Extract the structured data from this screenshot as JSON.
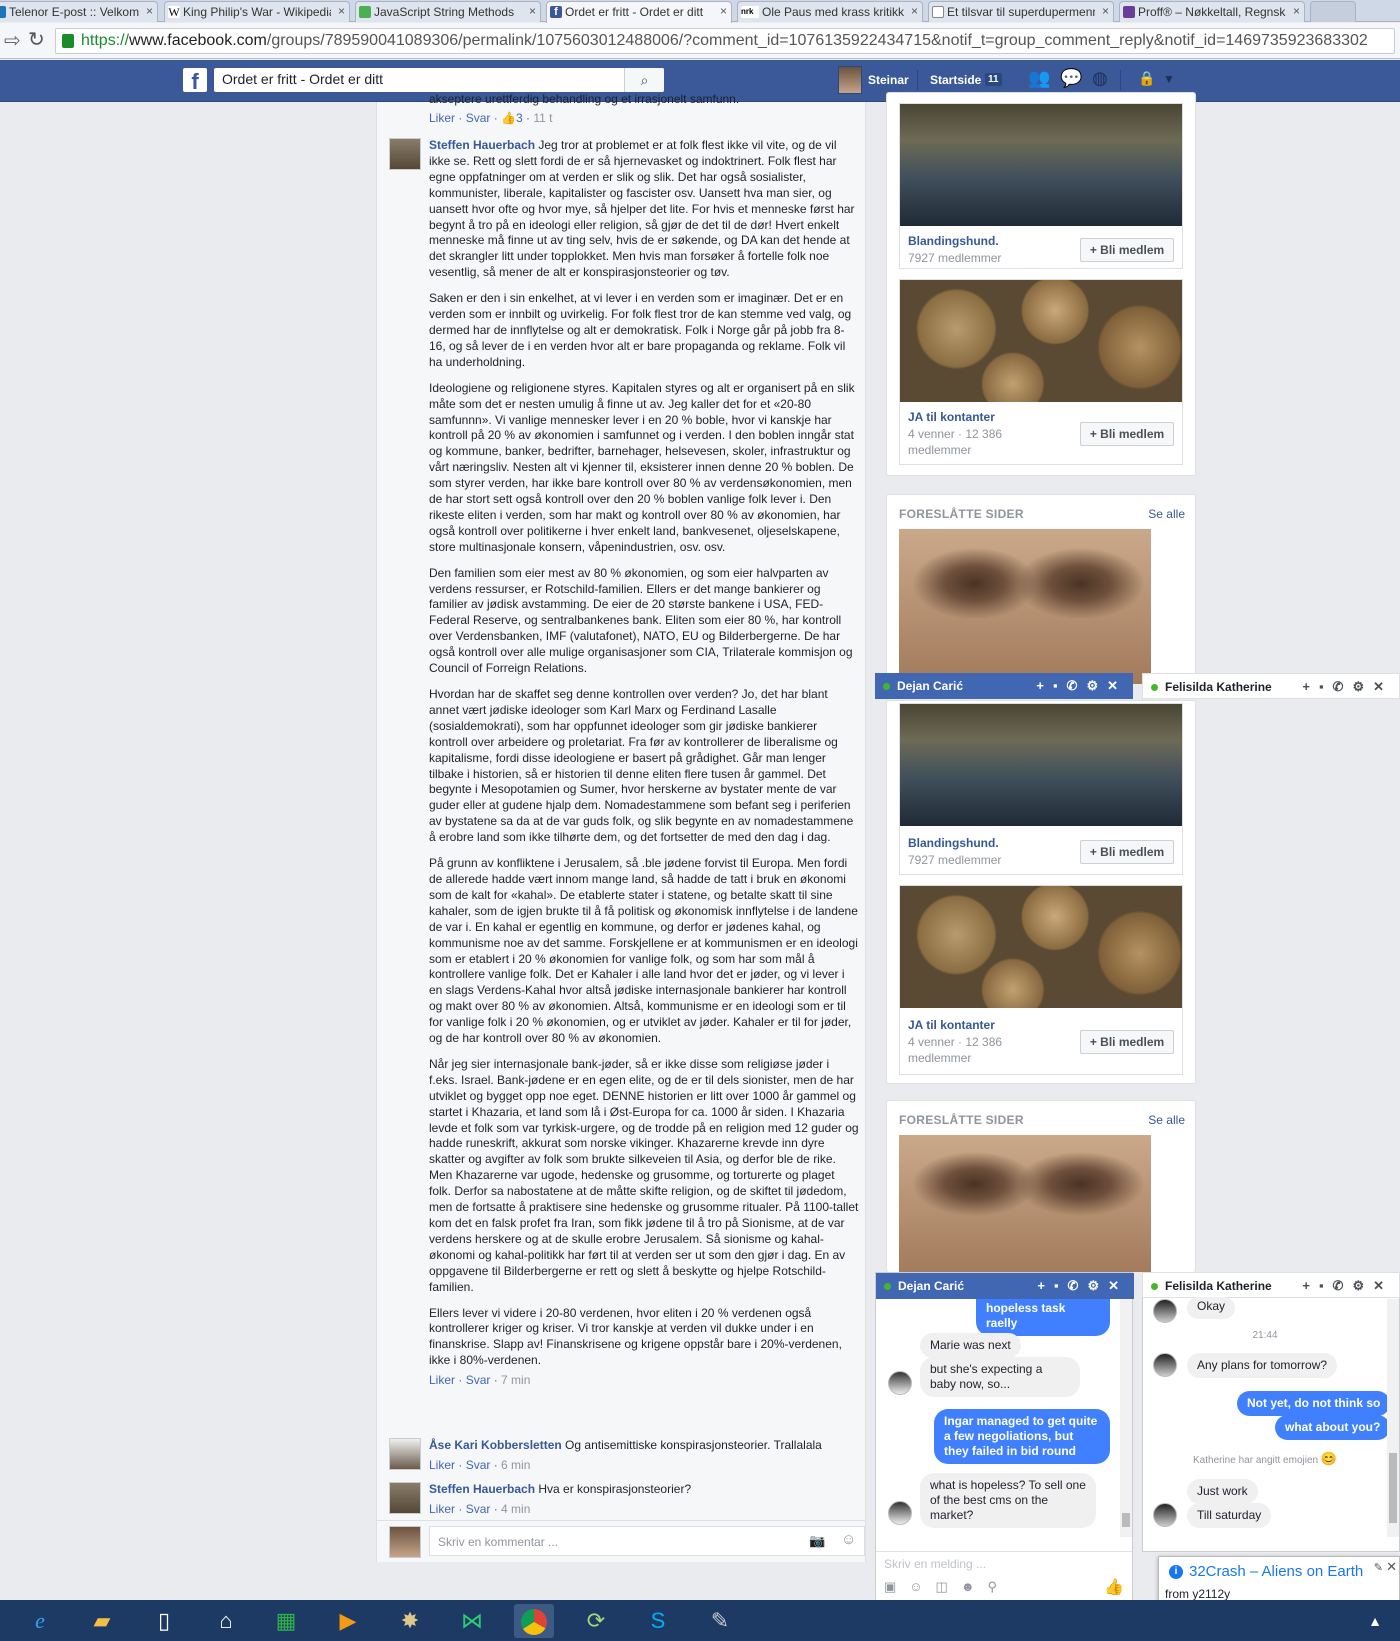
{
  "browser": {
    "tabs": [
      {
        "label": "Telenor E-post :: Velkommen",
        "active": false
      },
      {
        "label": "King Philip's War - Wikipedia",
        "active": false
      },
      {
        "label": "JavaScript String Methods",
        "active": false
      },
      {
        "label": "Ordet er fritt - Ordet er ditt",
        "active": true
      },
      {
        "label": "Ole Paus med krass kritikk",
        "active": false
      },
      {
        "label": "Et tilsvar til superdupermenneske",
        "active": false
      },
      {
        "label": "Proff® – Nøkkeltall, Regnskap",
        "active": false
      }
    ],
    "tab_favicons": [
      "",
      "W",
      "",
      "f",
      "nrk",
      "",
      ""
    ],
    "url_https": "https://",
    "url_host": "www.facebook.com",
    "url_path": "/groups/789590041089306/permalink/1075603012488006/?comment_id=1076135922434715&notif_t=group_comment_reply&notif_id=1469735923683302"
  },
  "navbar": {
    "logo": "f",
    "search_value": "Ordet er fritt - Ordet er ditt",
    "user_name": "Steinar",
    "home_label": "Startside",
    "home_count": "11"
  },
  "feed": {
    "top_fragment": "akseptere urettferdig behandling og et irrasjonelt samfunn.",
    "top_meta": {
      "like": "Liker",
      "reply": "Svar",
      "likes": "3",
      "time": "11 t"
    },
    "main_comment": {
      "author": "Steffen Hauerbach",
      "paragraphs": [
        "Jeg tror at problemet er at folk flest ikke vil vite, og de vil ikke se. Rett og slett fordi de er så hjernevasket og indoktrinert. Folk flest har egne oppfatninger om at verden er slik og slik. Det har også sosialister, kommunister, liberale, kapitalister og fascister osv. Uansett hva man sier, og uansett hvor ofte og hvor mye, så hjelper det lite. For hvis et menneske først har begynt å tro på en ideologi eller religion, så gjør de det til de dør! Hvert enkelt menneske må finne ut av ting selv, hvis de er søkende, og DA kan det hende at det skrangler litt under topplokket. Men hvis man forsøker å fortelle folk noe vesentlig, så mener de alt er konspirasjonsteorier og tøv.",
        "Saken er den i sin enkelhet, at vi lever i en verden som er imaginær. Det er en verden som er innbilt og uvirkelig. For folk flest tror de kan stemme ved valg, og dermed har de innflytelse og alt er demokratisk. Folk i Norge går på jobb fra 8-16, og så lever de i en verden hvor alt er bare propaganda og reklame. Folk vil ha underholdning.",
        "Ideologiene og religionene styres. Kapitalen styres og alt er organisert på en slik måte som det er nesten umulig å finne ut av. Jeg kaller det for et «20-80 samfunnn». Vi vanlige mennesker lever i en 20 % boble, hvor vi kanskje har kontroll på 20 % av økonomien i samfunnet og i verden. I den boblen inngår stat og kommune, banker, bedrifter, barnehager, helsevesen, skoler, infrastruktur og vårt næringsliv. Nesten alt vi kjenner til, eksisterer innen denne 20 % boblen. De som styrer verden, har ikke bare kontroll over 80 % av verdensøkonomien, men de har stort sett også kontroll over den 20 % boblen vanlige folk lever i. Den rikeste eliten i verden, som har makt og kontroll over 80 % av økonomien, har også kontroll over politikerne i hver enkelt land, bankvesenet, oljeselskapene, store multinasjonale konsern, våpenindustrien, osv. osv.",
        "Den familien som eier mest av 80 % økonomien, og som eier halvparten av verdens ressurser, er Rotschild-familien. Ellers er det mange bankierer og familier av jødisk avstamming. De eier de 20 største bankene i USA, FED-Federal Reserve, og sentralbankenes bank. Eliten som eier 80 %, har kontroll over Verdensbanken, IMF (valutafonet), NATO, EU og Bilderbergerne. De har også kontroll over alle mulige organisasjoner som CIA, Trilaterale kommisjon og Council of Forreign Relations.",
        "Hvordan har de skaffet seg denne kontrollen over verden? Jo, det har blant annet vært jødiske ideologer som Karl Marx og Ferdinand Lasalle (sosialdemokrati), som har oppfunnet ideologer som gir jødiske bankierer kontroll over arbeidere og proletariat. Fra før av kontrollerer de liberalisme og kapitalisme, fordi disse ideologiene er basert på grådighet. Går man lenger tilbake i historien, så er historien til denne eliten flere tusen år gammel. Det begynte i Mesopotamien og Sumer, hvor herskerne av bystater mente de var guder eller at gudene hjalp dem. Nomadestammene som befant seg i periferien av bystatene sa da at de var guds folk, og slik begynte en av nomadestammene å erobre land som ikke tilhørte dem, og det fortsetter de med den dag i dag.",
        "På grunn av konfliktene i Jerusalem, så .ble jødene forvist til Europa. Men fordi de allerede hadde vært innom mange land, så hadde de tatt i bruk en økonomi som de kalt for «kahal». De etablerte stater i statene, og betalte skatt til sine kahaler, som de igjen brukte til å få politisk og økonomisk innflytelse i de landene de var i. En kahal er egentlig en kommune, og derfor er jødenes kahal, og kommunisme noe av det samme. Forskjellene er at kommunismen er en ideologi som er etablert i 20 % økonomien for vanlige folk, og som har som mål å kontrollere vanlige folk. Det er Kahaler i alle land hvor det er jøder, og vi lever i en slags Verdens-Kahal hvor altså jødiske internasjonale bankierer har kontroll og makt over 80 % av økonomien. Altså, kommunisme er en ideologi som er til for vanlige folk i 20 % økonomien, og er utviklet av jøder. Kahaler er til for jøder, og de har kontroll over 80 % av økonomien.",
        "Når jeg sier internasjonale bank-jøder, så er ikke disse som religiøse jøder i f.eks. Israel. Bank-jødene er en egen elite, og de er til dels sionister, men de har utviklet og bygget opp noe eget. DENNE historien er litt over 1000 år gammel og startet i Khazaria, et land som lå i Øst-Europa for ca. 1000 år siden. I Khazaria levde et folk som var tyrkisk-urgere, og de trodde på en religion med 12 guder og hadde runeskrift, akkurat som norske vikinger. Khazarerne krevde inn dyre skatter og avgifter av folk som brukte silkeveien til Asia, og derfor ble de rike. Men Khazarerne var ugode, hedenske og grusomme, og torturerte og plaget folk. Derfor sa nabostatene at de måtte skifte religion, og de skiftet til jødedom, men de fortsatte å praktisere sine hedenske og grusomme ritualer. På 1100-tallet kom det en falsk profet fra Iran, som fikk jødene til å tro på Sionisme, at de var verdens herskere og at de skulle erobre Jerusalem. Så sionisme og kahal-økonomi og kahal-politikk har ført til at verden ser ut som den gjør i dag. En av oppgavene til Bilderbergerne er rett og slett å beskytte og hjelpe Rotschild-familien.",
        "Ellers lever vi videre i 20-80 verdenen, hvor eliten i 20 % verdenen også kontrollerer kriger og kriser. Vi tror kanskje at verden vil dukke under i en finanskrise. Slapp av! Finanskrisene og krigene oppstår bare i 20%-verdenen, ikke i 80%-verdenen."
      ],
      "meta": {
        "like": "Liker",
        "reply": "Svar",
        "time": "7 min"
      }
    },
    "reply1": {
      "author": "Åse Kari Kobbersletten",
      "text": "Og antisemittiske konspirasjonsteorier. Trallalala",
      "meta": {
        "like": "Liker",
        "reply": "Svar",
        "time": "6 min"
      }
    },
    "reply2": {
      "author": "Steffen Hauerbach",
      "text": "Hva er konspirasjonsteorier?",
      "meta": {
        "like": "Liker",
        "reply": "Svar",
        "time": "4 min"
      }
    },
    "comment_placeholder": "Skriv en kommentar ..."
  },
  "sidebar": {
    "groups": [
      {
        "name": "Blandingshund.",
        "members": "7927 medlemmer",
        "join": "+ Bli medlem"
      },
      {
        "name": "JA til kontanter",
        "members": "4 venner · 12 386 medlemmer",
        "join": "+ Bli medlem"
      }
    ],
    "suggested_pages": "FORESLÅTTE SIDER",
    "see_all": "Se alle"
  },
  "chat": {
    "tab1": "Dejan Carić",
    "tab2": "Felisilda Katherine",
    "dejan_fragment": "hopeless task raelly",
    "dejan_messages": [
      {
        "dir": "in",
        "text": "Marie was next"
      },
      {
        "dir": "in",
        "text": "but she's expecting a baby now, so..."
      },
      {
        "dir": "out",
        "text": "Ingar managed to get quite a few negoliations, but they failed in bid round"
      },
      {
        "dir": "in",
        "text": "what is hopeless? To sell one of the best cms on the market?"
      }
    ],
    "kath_messages": [
      {
        "dir": "in",
        "text": "Okay"
      },
      {
        "dir": "time",
        "text": "21:44"
      },
      {
        "dir": "in",
        "text": "Any plans for tomorrow?"
      },
      {
        "dir": "out",
        "text": "Not yet, do not think so"
      },
      {
        "dir": "out",
        "text": "what about you?"
      },
      {
        "dir": "note",
        "text": "Katherine har angitt emojien"
      },
      {
        "dir": "in",
        "text": "Just work"
      },
      {
        "dir": "in",
        "text": "Till saturday"
      }
    ],
    "input_placeholder": "Skriv en melding ..."
  },
  "notification": {
    "title": "32Crash – Aliens on Earth",
    "from": "from y2112y"
  },
  "colors": {
    "facebook_blue": "#3b5998",
    "link": "#365899",
    "messenger_blue": "#4080ff",
    "online": "#42b72a"
  }
}
